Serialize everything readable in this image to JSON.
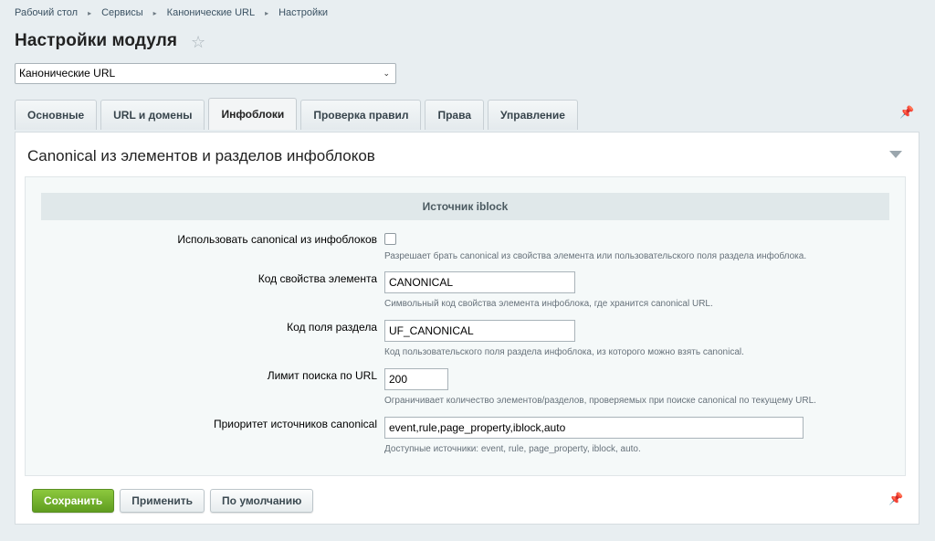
{
  "breadcrumb": [
    "Рабочий стол",
    "Сервисы",
    "Канонические URL",
    "Настройки"
  ],
  "page_title": "Настройки модуля",
  "module_select": {
    "value": "Канонические URL"
  },
  "tabs": [
    {
      "label": "Основные"
    },
    {
      "label": "URL и домены"
    },
    {
      "label": "Инфоблоки",
      "active": true
    },
    {
      "label": "Проверка правил"
    },
    {
      "label": "Права"
    },
    {
      "label": "Управление"
    }
  ],
  "section": {
    "title": "Canonical из элементов и разделов инфоблоков",
    "subheader": "Источник iblock",
    "fields": {
      "use_canonical": {
        "label": "Использовать canonical из инфоблоков",
        "checked": false,
        "hint": "Разрешает брать canonical из свойства элемента или пользовательского поля раздела инфоблока."
      },
      "element_prop": {
        "label": "Код свойства элемента",
        "value": "CANONICAL",
        "hint": "Символьный код свойства элемента инфоблока, где хранится canonical URL."
      },
      "section_field": {
        "label": "Код поля раздела",
        "value": "UF_CANONICAL",
        "hint": "Код пользовательского поля раздела инфоблока, из которого можно взять canonical."
      },
      "search_limit": {
        "label": "Лимит поиска по URL",
        "value": "200",
        "hint": "Ограничивает количество элементов/разделов, проверяемых при поиске canonical по текущему URL."
      },
      "priority": {
        "label": "Приоритет источников canonical",
        "value": "event,rule,page_property,iblock,auto",
        "hint": "Доступные источники: event, rule, page_property, iblock, auto."
      }
    }
  },
  "buttons": {
    "save": "Сохранить",
    "apply": "Применить",
    "default": "По умолчанию"
  },
  "colors": {
    "primary_button": "#6aab27",
    "background": "#e8eef1"
  }
}
